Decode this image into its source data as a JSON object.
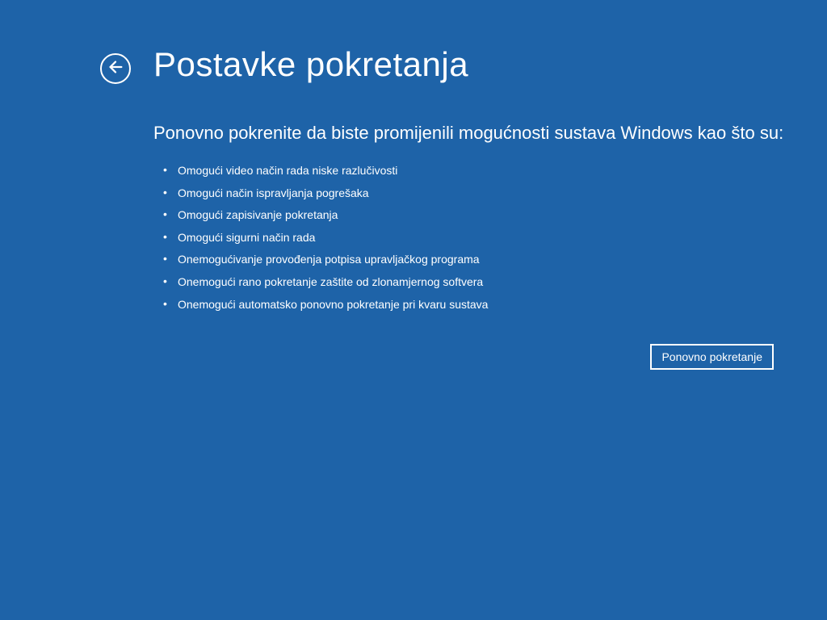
{
  "header": {
    "title": "Postavke pokretanja"
  },
  "main": {
    "subtitle": "Ponovno pokrenite da biste promijenili mogućnosti sustava Windows kao što su:",
    "options": [
      "Omogući video način rada niske razlučivosti",
      "Omogući način ispravljanja pogrešaka",
      "Omogući zapisivanje pokretanja",
      "Omogući sigurni način rada",
      "Onemogućivanje provođenja potpisa upravljačkog programa",
      "Onemogući rano pokretanje zaštite od zlonamjernog softvera",
      "Onemogući automatsko ponovno pokretanje pri kvaru sustava"
    ]
  },
  "actions": {
    "restart_label": "Ponovno pokretanje"
  }
}
